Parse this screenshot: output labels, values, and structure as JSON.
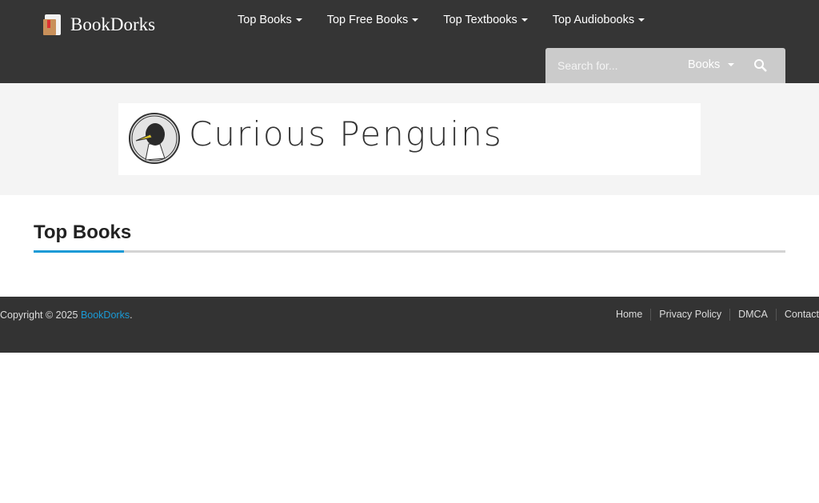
{
  "header": {
    "logo": "BookDorks",
    "nav": [
      "Top Books",
      "Top Free Books",
      "Top Textbooks",
      "Top Audiobooks"
    ],
    "search": {
      "placeholder": "Search for...",
      "category": "Books"
    }
  },
  "banner": {
    "text": "Curious Penguins"
  },
  "main": {
    "title": "Top Books"
  },
  "footer": {
    "copyright": "Copyright © 2025 ",
    "brand": "BookDorks",
    "period": ".",
    "links": [
      "Home",
      "Privacy Policy",
      "DMCA",
      "Contact"
    ]
  },
  "colors": {
    "accent": "#1a9ad6",
    "header": "#353535"
  }
}
